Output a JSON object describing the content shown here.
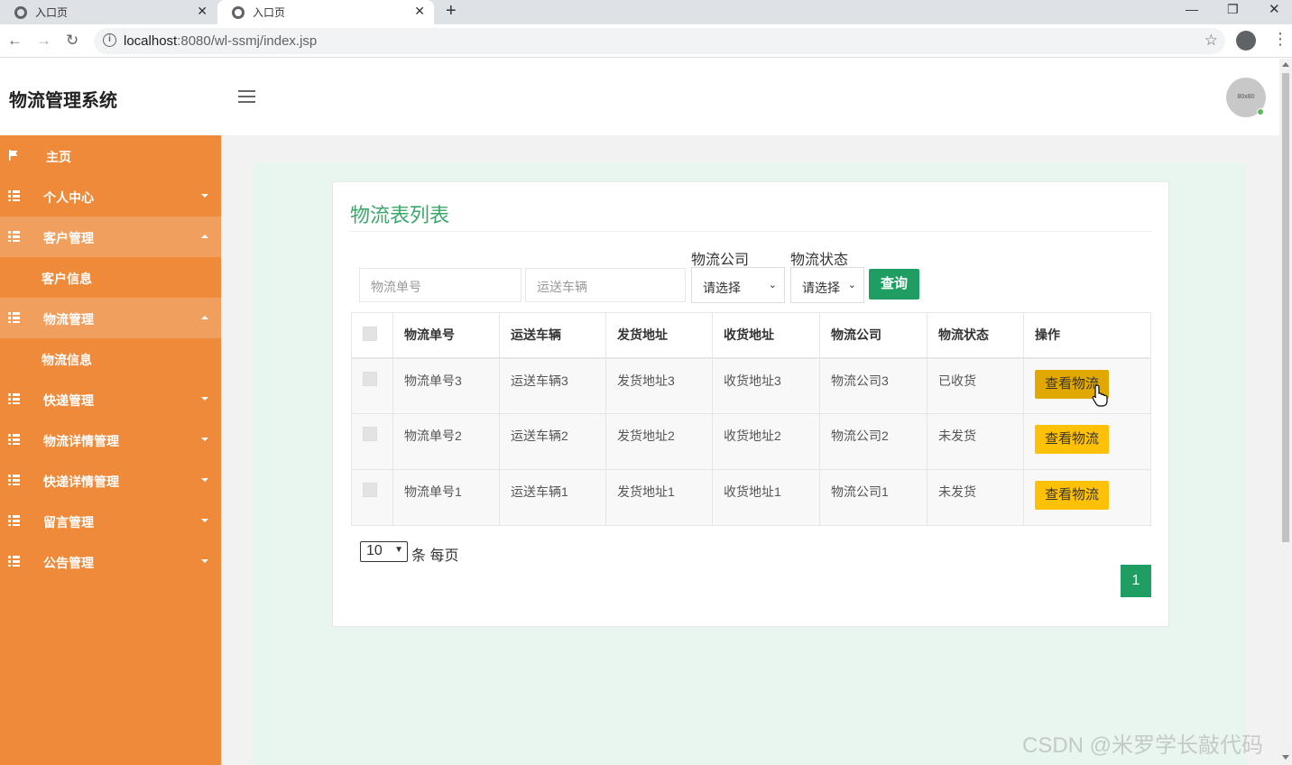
{
  "browser": {
    "tabs": [
      {
        "label": "入口页"
      },
      {
        "label": "入口页"
      }
    ],
    "url_host": "localhost",
    "url_rest": ":8080/wl-ssmj/index.jsp"
  },
  "header": {
    "title": "物流管理系统",
    "avatar_text": "80x80"
  },
  "sidebar": {
    "items": [
      {
        "label": "主页"
      },
      {
        "label": "个人中心"
      },
      {
        "label": "客户管理"
      },
      {
        "label": "客户信息"
      },
      {
        "label": "物流管理"
      },
      {
        "label": "物流信息"
      },
      {
        "label": "快递管理"
      },
      {
        "label": "物流详情管理"
      },
      {
        "label": "快递详情管理"
      },
      {
        "label": "留言管理"
      },
      {
        "label": "公告管理"
      }
    ]
  },
  "main": {
    "title": "物流表列表",
    "search": {
      "order_no_placeholder": "物流单号",
      "vehicle_placeholder": "运送车辆",
      "company_label": "物流公司",
      "company_value": "请选择",
      "status_label": "物流状态",
      "status_value": "请选择",
      "query_label": "查询"
    },
    "table": {
      "headers": [
        "物流单号",
        "运送车辆",
        "发货地址",
        "收货地址",
        "物流公司",
        "物流状态",
        "操作"
      ],
      "rows": [
        {
          "order": "物流单号3",
          "vehicle": "运送车辆3",
          "from": "发货地址3",
          "to": "收货地址3",
          "company": "物流公司3",
          "status": "已收货",
          "action": "查看物流"
        },
        {
          "order": "物流单号2",
          "vehicle": "运送车辆2",
          "from": "发货地址2",
          "to": "收货地址2",
          "company": "物流公司2",
          "status": "未发货",
          "action": "查看物流"
        },
        {
          "order": "物流单号1",
          "vehicle": "运送车辆1",
          "from": "发货地址1",
          "to": "收货地址1",
          "company": "物流公司1",
          "status": "未发货",
          "action": "查看物流"
        }
      ]
    },
    "pagination": {
      "page_size": "10",
      "page_size_label": "条 每页",
      "current_page": "1"
    }
  },
  "watermark": "CSDN @米罗学长敲代码",
  "colors": {
    "sidebar": "#ee8a3a",
    "accent_green": "#1f9d63",
    "title_green": "#3aa86a",
    "button_yellow": "#ffc107"
  }
}
